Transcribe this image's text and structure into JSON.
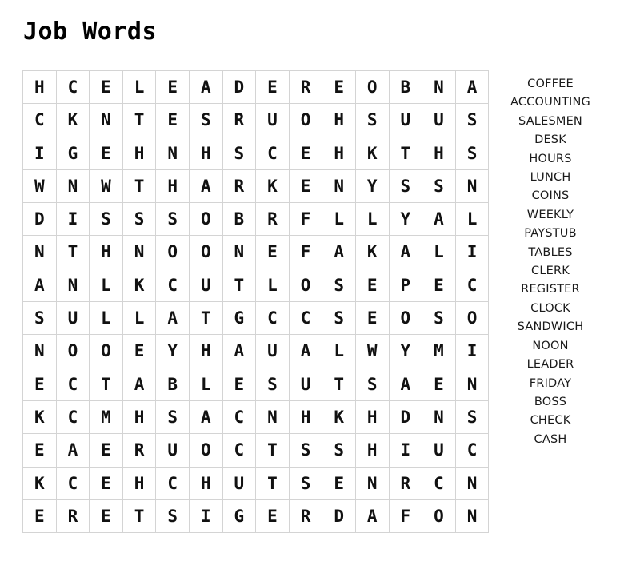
{
  "puzzle": {
    "title": "Job Words",
    "grid_rows": 14,
    "grid_cols": 14,
    "grid": [
      [
        "H",
        "C",
        "E",
        "L",
        "E",
        "A",
        "D",
        "E",
        "R",
        "E",
        "O",
        "B",
        "N",
        "A"
      ],
      [
        "C",
        "K",
        "N",
        "T",
        "E",
        "S",
        "R",
        "U",
        "O",
        "H",
        "S",
        "U",
        "U",
        "S"
      ],
      [
        "I",
        "G",
        "E",
        "H",
        "N",
        "H",
        "S",
        "C",
        "E",
        "H",
        "K",
        "T",
        "H",
        "S"
      ],
      [
        "W",
        "N",
        "W",
        "T",
        "H",
        "A",
        "R",
        "K",
        "E",
        "N",
        "Y",
        "S",
        "S",
        "N"
      ],
      [
        "D",
        "I",
        "S",
        "S",
        "S",
        "O",
        "B",
        "R",
        "F",
        "L",
        "L",
        "Y",
        "A",
        "L"
      ],
      [
        "N",
        "T",
        "H",
        "N",
        "O",
        "O",
        "N",
        "E",
        "F",
        "A",
        "K",
        "A",
        "L",
        "I"
      ],
      [
        "A",
        "N",
        "L",
        "K",
        "C",
        "U",
        "T",
        "L",
        "O",
        "S",
        "E",
        "P",
        "E",
        "C"
      ],
      [
        "S",
        "U",
        "L",
        "L",
        "A",
        "T",
        "G",
        "C",
        "C",
        "S",
        "E",
        "O",
        "S",
        "O"
      ],
      [
        "N",
        "O",
        "O",
        "E",
        "Y",
        "H",
        "A",
        "U",
        "A",
        "L",
        "W",
        "Y",
        "M",
        "I"
      ],
      [
        "E",
        "C",
        "T",
        "A",
        "B",
        "L",
        "E",
        "S",
        "U",
        "T",
        "S",
        "A",
        "E",
        "N"
      ],
      [
        "K",
        "C",
        "M",
        "H",
        "S",
        "A",
        "C",
        "N",
        "H",
        "K",
        "H",
        "D",
        "N",
        "S"
      ],
      [
        "E",
        "A",
        "E",
        "R",
        "U",
        "O",
        "C",
        "T",
        "S",
        "S",
        "H",
        "I",
        "U",
        "C"
      ],
      [
        "K",
        "C",
        "E",
        "H",
        "C",
        "H",
        "U",
        "T",
        "S",
        "E",
        "N",
        "R",
        "C",
        "N"
      ],
      [
        "E",
        "R",
        "E",
        "T",
        "S",
        "I",
        "G",
        "E",
        "R",
        "D",
        "A",
        "F",
        "O",
        "N"
      ]
    ],
    "words": [
      "COFFEE",
      "ACCOUNTING",
      "SALESMEN",
      "DESK",
      "HOURS",
      "LUNCH",
      "COINS",
      "WEEKLY",
      "PAYSTUB",
      "TABLES",
      "CLERK",
      "REGISTER",
      "CLOCK",
      "SANDWICH",
      "NOON",
      "LEADER",
      "FRIDAY",
      "BOSS",
      "CHECK",
      "CASH"
    ],
    "colors": {
      "text": "#111111",
      "cell_border": "#d4d4d4",
      "background": "#ffffff",
      "word_text": "#1a1a1a"
    }
  }
}
